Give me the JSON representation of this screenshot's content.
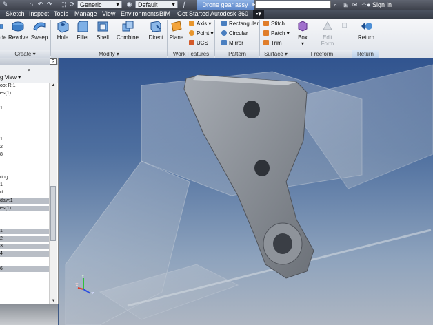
{
  "quick_access": {
    "appearance_combo": "Generic",
    "material_combo": "Default",
    "document_title": "Drone gear assy",
    "sign_in": "Sign In"
  },
  "menu_tabs": [
    "Sketch",
    "Inspect",
    "Tools",
    "Manage",
    "View",
    "Environments",
    "BIM",
    "Get Started",
    "Autodesk 360"
  ],
  "ribbon": {
    "create": {
      "buttons": [
        "de",
        "Revolve",
        "Sweep"
      ],
      "panel": "Create"
    },
    "modify": {
      "buttons": [
        "Hole",
        "Fillet",
        "Shell",
        "Combine",
        "Direct"
      ],
      "panel": "Modify"
    },
    "work_features": {
      "plane": "Plane",
      "axis": "Axis",
      "point": "Point",
      "ucs": "UCS",
      "panel": "Work Features"
    },
    "pattern": {
      "rectangular": "Rectangular",
      "circular": "Circular",
      "mirror": "Mirror",
      "panel": "Pattern"
    },
    "surface": {
      "stitch": "Stitch",
      "patch": "Patch",
      "trim": "Trim",
      "panel": "Surface"
    },
    "freeform": {
      "box": "Box",
      "edit_form": "Edit Form",
      "panel": "Freeform"
    },
    "return": {
      "button": "Return",
      "panel": "Return"
    }
  },
  "browser": {
    "view": "g View",
    "rows": [
      {
        "text": "oot R:1",
        "sel": false
      },
      {
        "text": "es(1)",
        "sel": false
      },
      {
        "text": "",
        "sel": false
      },
      {
        "text": "1",
        "sel": false
      },
      {
        "text": "",
        "sel": false
      },
      {
        "text": "",
        "sel": false
      },
      {
        "text": "",
        "sel": false
      },
      {
        "text": "1",
        "sel": false
      },
      {
        "text": "2",
        "sel": false
      },
      {
        "text": "8",
        "sel": false
      },
      {
        "text": "",
        "sel": false
      },
      {
        "text": "",
        "sel": false
      },
      {
        "text": "ring",
        "sel": false
      },
      {
        "text": "1",
        "sel": false
      },
      {
        "text": "rt",
        "sel": false
      },
      {
        "text": "daw:1",
        "sel": true
      },
      {
        "text": "es(1)",
        "sel": true
      },
      {
        "text": "",
        "sel": true
      },
      {
        "text": "",
        "sel": true
      },
      {
        "text": "1",
        "sel": true
      },
      {
        "text": "2",
        "sel": true
      },
      {
        "text": "3",
        "sel": true
      },
      {
        "text": "4",
        "sel": true
      },
      {
        "text": "",
        "sel": true
      },
      {
        "text": "6",
        "sel": true
      }
    ]
  },
  "triad": {
    "x": "X",
    "y": "Y",
    "z": "Z"
  },
  "colors": {
    "accent": "#5d86c8",
    "viewport_top": "#31548f",
    "viewport_bottom": "#aeb6c2"
  }
}
